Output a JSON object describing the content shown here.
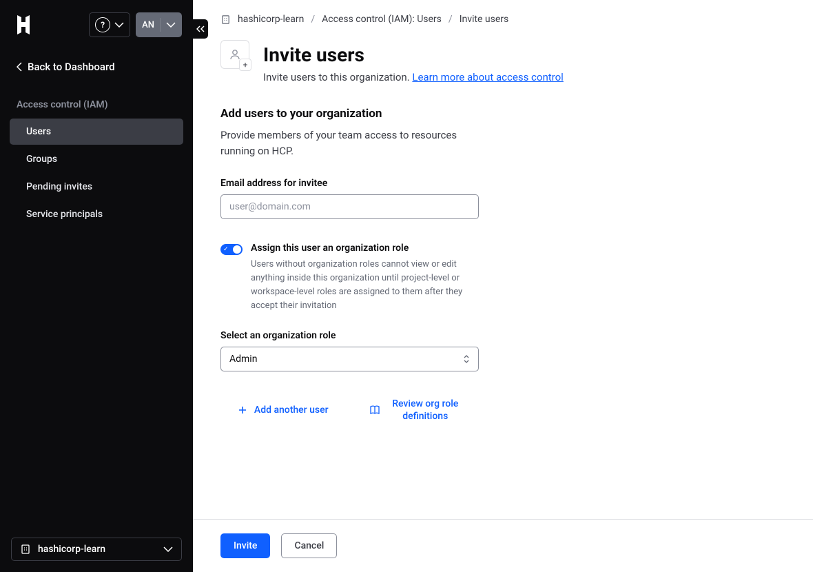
{
  "sidebar": {
    "org_badge": "AN",
    "back_label": "Back to Dashboard",
    "section_heading": "Access control (IAM)",
    "items": [
      {
        "label": "Users",
        "active": true
      },
      {
        "label": "Groups",
        "active": false
      },
      {
        "label": "Pending invites",
        "active": false
      },
      {
        "label": "Service principals",
        "active": false
      }
    ],
    "org_selector": "hashicorp-learn"
  },
  "breadcrumbs": {
    "items": [
      "hashicorp-learn",
      "Access control (IAM): Users",
      "Invite users"
    ],
    "sep": "/"
  },
  "header": {
    "title": "Invite users",
    "desc": "Invite users to this organization. ",
    "learn_more": "Learn more about access control"
  },
  "form": {
    "section_title": "Add users to your organization",
    "section_desc": "Provide members of your team access to resources running on HCP.",
    "email_label": "Email address for invitee",
    "email_placeholder": "user@domain.com",
    "toggle_title": "Assign this user an organization role",
    "toggle_desc": "Users without organization roles cannot view or edit anything inside this organization until project-level or workspace-level roles are assigned to them after they accept their invitation",
    "role_label": "Select an organization role",
    "role_value": "Admin",
    "add_another": "Add another user",
    "review_roles": "Review org role definitions"
  },
  "footer": {
    "invite": "Invite",
    "cancel": "Cancel"
  }
}
